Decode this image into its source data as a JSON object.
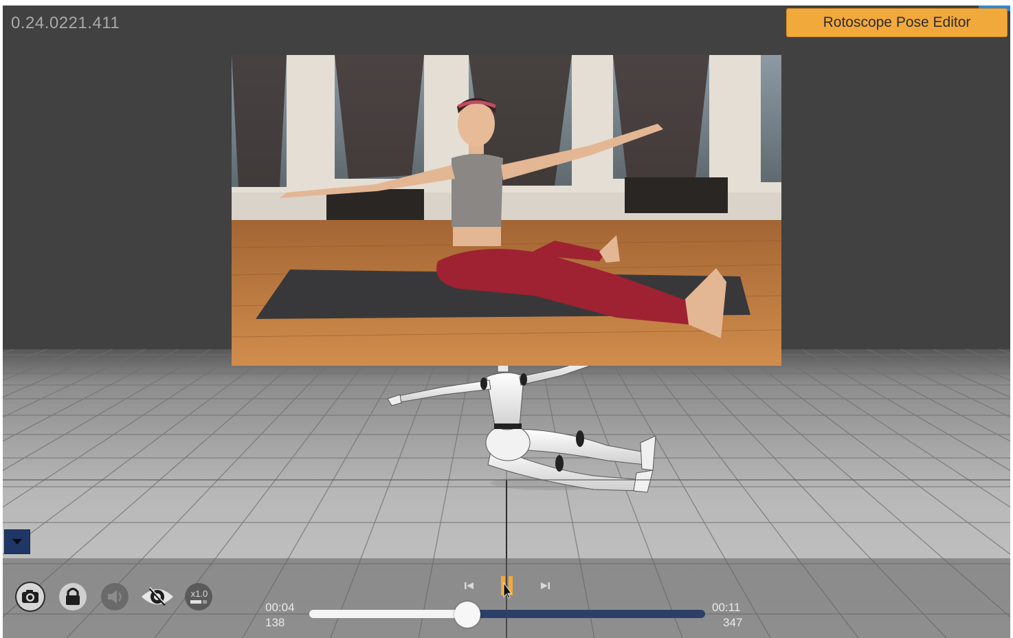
{
  "app": {
    "version": "0.24.0221.411",
    "mode_button_label": "Rotoscope Pose Editor"
  },
  "toolbar": {
    "tools": [
      {
        "name": "camera-icon"
      },
      {
        "name": "lock-icon"
      },
      {
        "name": "speaker-icon"
      },
      {
        "name": "eye-hidden-icon"
      },
      {
        "name": "playback-speed-icon",
        "label": "x1.0"
      }
    ]
  },
  "timeline": {
    "current_time": "00:04",
    "current_frame": "138",
    "end_time": "00:11",
    "end_frame": "347",
    "progress": 0.4
  },
  "transport": {
    "prev_icon": "skip-back-icon",
    "pause_icon": "pause-icon",
    "next_icon": "skip-forward-icon"
  },
  "colors": {
    "accent": "#f2a93c",
    "panel": "#414141",
    "slider_fill": "#f4f4f4",
    "slider_track": "#2b4068",
    "toggle": "#1f3766"
  }
}
